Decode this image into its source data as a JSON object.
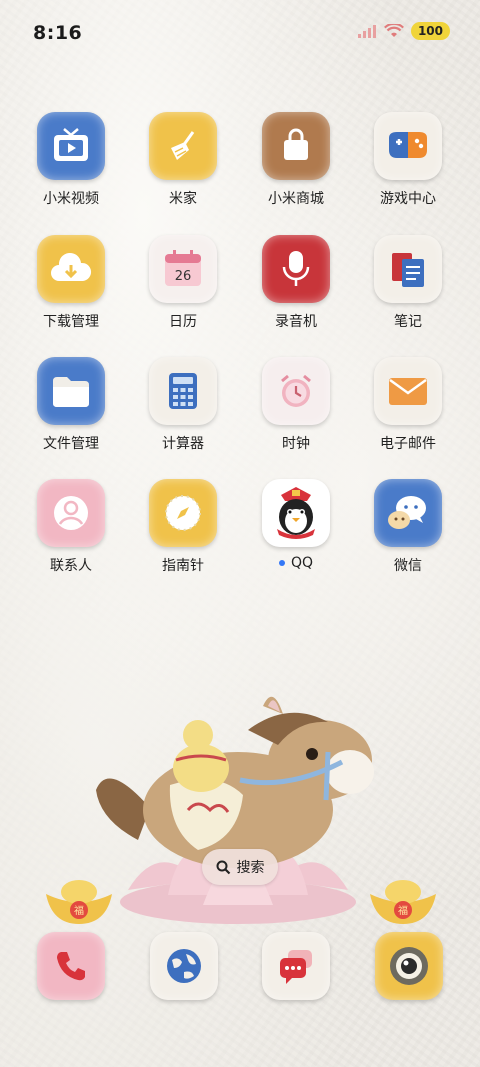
{
  "status": {
    "time": "8:16",
    "battery": "100"
  },
  "apps": [
    {
      "label": "小米视频",
      "icon": "tv-icon",
      "color": "#4a7bc9"
    },
    {
      "label": "米家",
      "icon": "broom-icon",
      "color": "#f0c24a"
    },
    {
      "label": "小米商城",
      "icon": "shopping-bag-icon",
      "color": "#b07a4e"
    },
    {
      "label": "游戏中心",
      "icon": "gamepad-icon",
      "color": "#f3efe8"
    },
    {
      "label": "下载管理",
      "icon": "download-cloud-icon",
      "color": "#f0c24a"
    },
    {
      "label": "日历",
      "icon": "calendar-icon",
      "color": "#f6f0ee",
      "day": "26"
    },
    {
      "label": "录音机",
      "icon": "microphone-icon",
      "color": "#c8353a"
    },
    {
      "label": "笔记",
      "icon": "notebook-icon",
      "color": "#f3efe8"
    },
    {
      "label": "文件管理",
      "icon": "folder-icon",
      "color": "#4a7bc9"
    },
    {
      "label": "计算器",
      "icon": "calculator-icon",
      "color": "#f3efe8"
    },
    {
      "label": "时钟",
      "icon": "alarm-clock-icon",
      "color": "#f6eeee"
    },
    {
      "label": "电子邮件",
      "icon": "envelope-icon",
      "color": "#f3efe8"
    },
    {
      "label": "联系人",
      "icon": "contact-icon",
      "color": "#f2b7c3"
    },
    {
      "label": "指南针",
      "icon": "compass-icon",
      "color": "#f0c24a"
    },
    {
      "label": "QQ",
      "icon": "qq-penguin-icon",
      "color": "#ffffff",
      "new": true
    },
    {
      "label": "微信",
      "icon": "wechat-icon",
      "color": "#4a7bc9"
    }
  ],
  "search": {
    "label": "搜索"
  },
  "dock": [
    {
      "icon": "phone-icon",
      "color": "#f2b7c3"
    },
    {
      "icon": "browser-globe-icon",
      "color": "#f3efe8"
    },
    {
      "icon": "messages-icon",
      "color": "#f3efe8"
    },
    {
      "icon": "camera-icon",
      "color": "#f0c24a"
    }
  ],
  "decor": {
    "ingot_char": "福"
  }
}
